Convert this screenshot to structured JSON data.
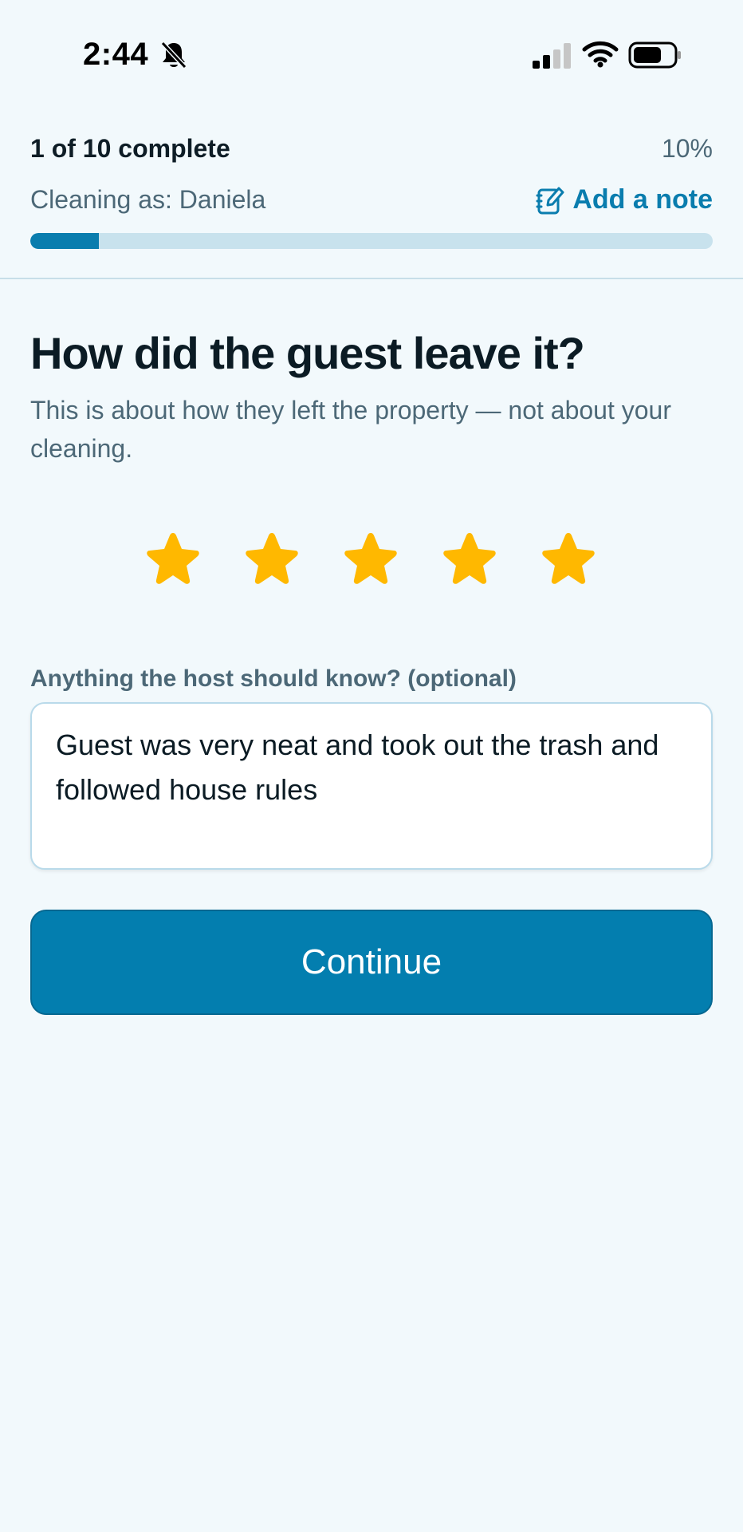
{
  "status_bar": {
    "time": "2:44",
    "icons": [
      "bell-slash-icon",
      "cellular-signal-icon",
      "wifi-icon",
      "battery-icon"
    ]
  },
  "progress": {
    "complete_label": "1 of 10 complete",
    "percent_label": "10%",
    "fraction": 0.1,
    "cleaning_as": "Cleaning as: Daniela",
    "add_note_label": "Add a note"
  },
  "question": {
    "title": "How did the guest leave it?",
    "subtitle": "This is about how they left the property — not about your cleaning."
  },
  "rating": {
    "value": 5,
    "max": 5
  },
  "notes": {
    "label": "Anything the host should know? (optional)",
    "value": "Guest was very neat and took out the trash and followed house rules"
  },
  "actions": {
    "continue_label": "Continue"
  },
  "colors": {
    "accent": "#0A7DAE",
    "star": "#FFB800",
    "background": "#F2F9FC",
    "muted_text": "#4C6877",
    "track": "#C8E2ED"
  }
}
